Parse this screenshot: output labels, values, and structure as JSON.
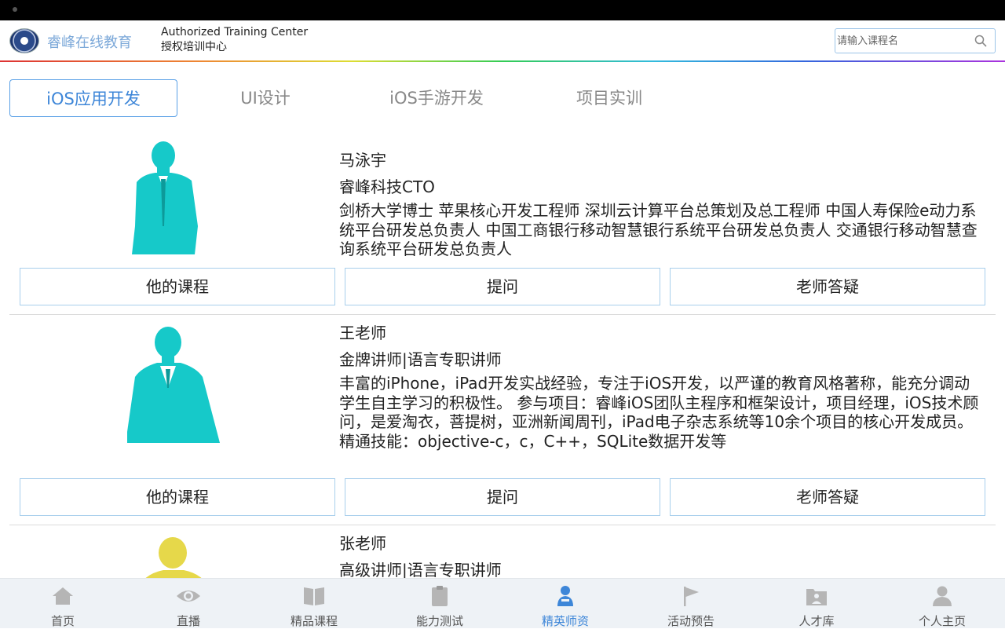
{
  "header": {
    "brand": "睿峰在线教育",
    "atc_en": "Authorized Training Center",
    "atc_cn": "授权培训中心",
    "search_placeholder": "请输入课程名"
  },
  "tabs": [
    {
      "label": "iOS应用开发",
      "active": true
    },
    {
      "label": "UI设计",
      "active": false
    },
    {
      "label": "iOS手游开发",
      "active": false
    },
    {
      "label": "项目实训",
      "active": false
    }
  ],
  "teachers": [
    {
      "name": "马泳宇",
      "title": "睿峰科技CTO",
      "desc": "剑桥大学博士 苹果核心开发工程师 深圳云计算平台总策划及总工程师 中国人寿保险e动力系统平台研发总负责人 中国工商银行移动智慧银行系统平台研发总负责人 交通银行移动智慧查询系统平台研发总负责人",
      "avatar_color": "#16c9c9"
    },
    {
      "name": "王老师",
      "title": "金牌讲师|语言专职讲师",
      "desc": "丰富的iPhone，iPad开发实战经验，专注于iOS开发，以严谨的教育风格著称，能充分调动学生自主学习的积极性。 参与项目：睿峰iOS团队主程序和框架设计，项目经理，iOS技术顾问，是爱淘衣，菩提树，亚洲新闻周刊，iPad电子杂志系统等10余个项目的核心开发成员。 精通技能：objective-c，c，C++，SQLite数据开发等",
      "avatar_color": "#16c9c9"
    },
    {
      "name": "张老师",
      "title": "高级讲师|语言专职讲师",
      "desc": "",
      "avatar_color": "#e6d84a"
    }
  ],
  "buttons": {
    "courses": "他的课程",
    "ask": "提问",
    "answer": "老师答疑"
  },
  "nav": [
    {
      "label": "首页",
      "icon": "home-icon",
      "active": false
    },
    {
      "label": "直播",
      "icon": "eye-icon",
      "active": false
    },
    {
      "label": "精品课程",
      "icon": "book-icon",
      "active": false
    },
    {
      "label": "能力测试",
      "icon": "clipboard-icon",
      "active": false
    },
    {
      "label": "精英师资",
      "icon": "teacher-icon",
      "active": true
    },
    {
      "label": "活动预告",
      "icon": "flag-icon",
      "active": false
    },
    {
      "label": "人才库",
      "icon": "folder-people-icon",
      "active": false
    },
    {
      "label": "个人主页",
      "icon": "person-icon",
      "active": false
    }
  ],
  "colors": {
    "accent": "#3d86d8",
    "tab_border": "#5aa0e6",
    "button_border": "#a9cfec",
    "nav_bg": "#eef2f6",
    "icon_gray": "#b5b5b5"
  }
}
